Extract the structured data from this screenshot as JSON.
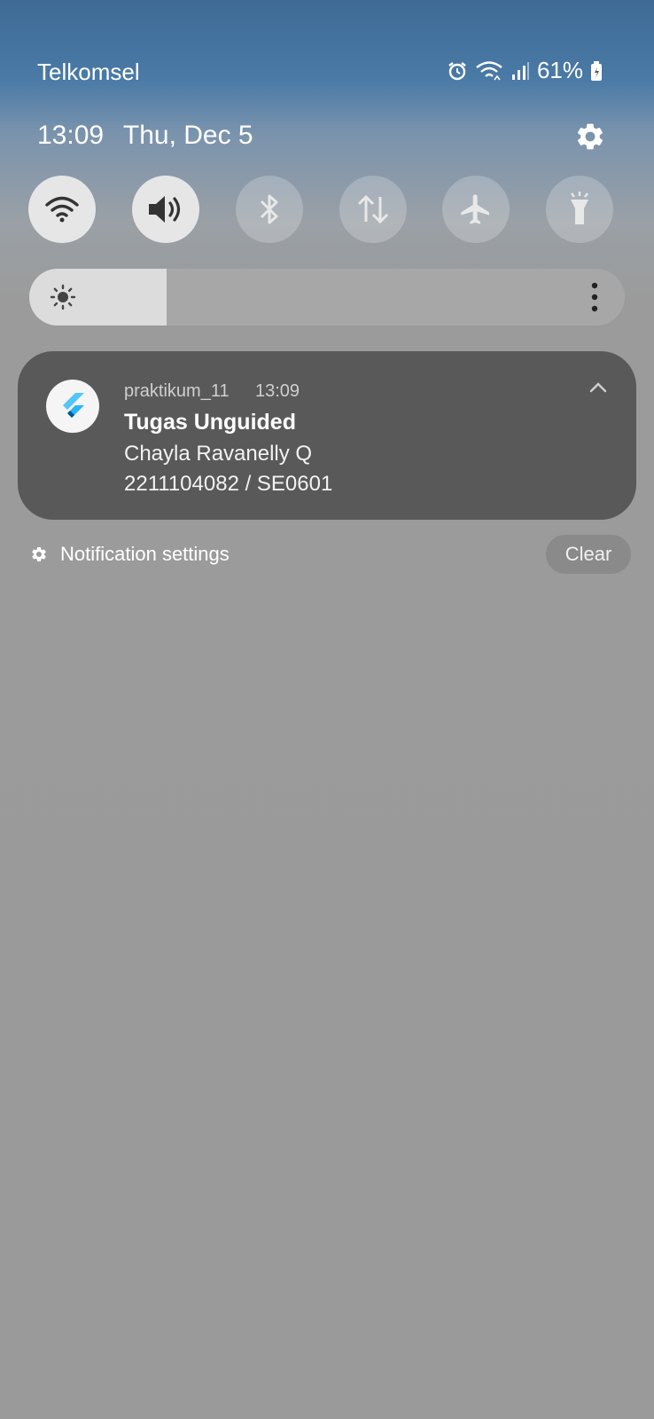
{
  "status": {
    "carrier": "Telkomsel",
    "battery": "61%",
    "icons": [
      "alarm-icon",
      "wifi-icon",
      "signal-icon",
      "battery-icon"
    ]
  },
  "header": {
    "time": "13:09",
    "date": "Thu, Dec 5"
  },
  "quick_toggles": [
    {
      "name": "wifi",
      "state": "on"
    },
    {
      "name": "sound",
      "state": "on"
    },
    {
      "name": "bluetooth",
      "state": "off"
    },
    {
      "name": "mobile-data",
      "state": "off"
    },
    {
      "name": "airplane-mode",
      "state": "off"
    },
    {
      "name": "flashlight",
      "state": "off"
    }
  ],
  "brightness": {
    "level": 0.23
  },
  "notification": {
    "app": "praktikum_11",
    "time": "13:09",
    "title": "Tugas Unguided",
    "line1": "Chayla Ravanelly Q",
    "line2": "2211104082 / SE0601"
  },
  "footer": {
    "settings_label": "Notification settings",
    "clear_label": "Clear"
  },
  "colors": {
    "notification_bg": "#595959",
    "toggle_on": "#e6e6e6",
    "background": "#9a9a9a"
  }
}
